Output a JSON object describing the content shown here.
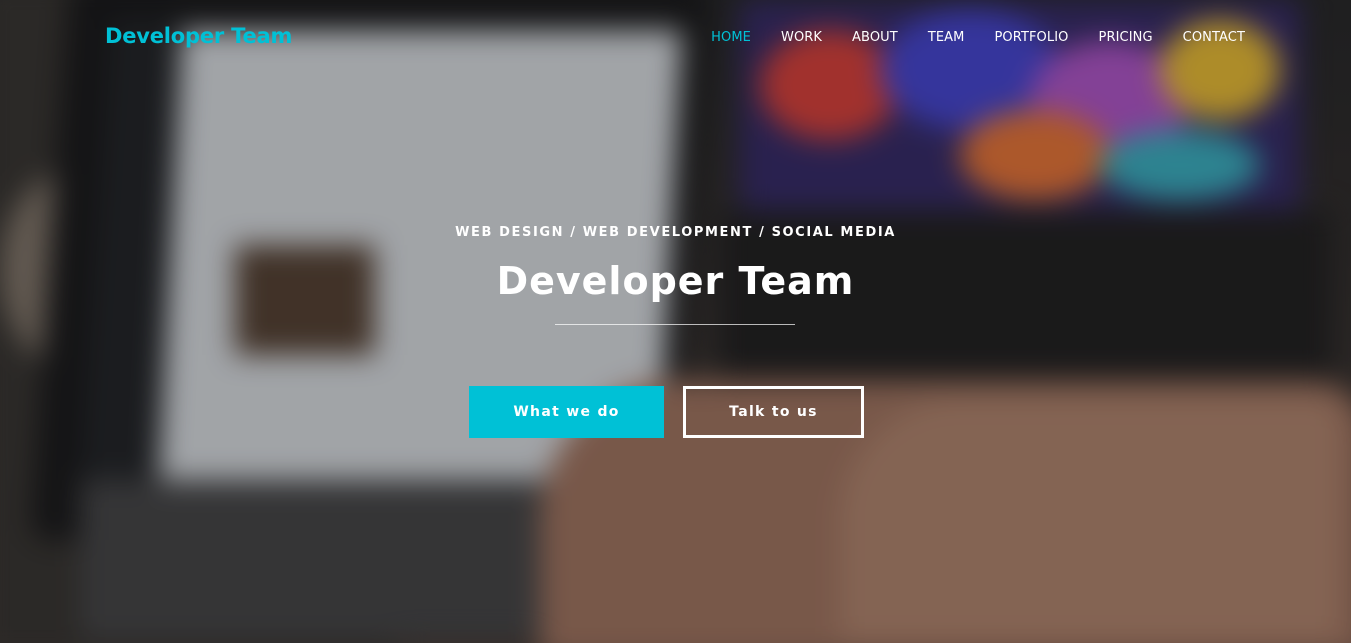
{
  "brand": "Developer Team",
  "nav": {
    "items": [
      {
        "label": "HOME",
        "active": true
      },
      {
        "label": "WORK",
        "active": false
      },
      {
        "label": "ABOUT",
        "active": false
      },
      {
        "label": "TEAM",
        "active": false
      },
      {
        "label": "PORTFOLIO",
        "active": false
      },
      {
        "label": "PRICING",
        "active": false
      },
      {
        "label": "CONTACT",
        "active": false
      }
    ]
  },
  "hero": {
    "tagline": "WEB DESIGN / WEB DEVELOPMENT / SOCIAL MEDIA",
    "title": "Developer Team",
    "primary_button": "What we do",
    "secondary_button": "Talk to us"
  },
  "colors": {
    "accent": "#00c1d6",
    "text": "#ffffff"
  }
}
